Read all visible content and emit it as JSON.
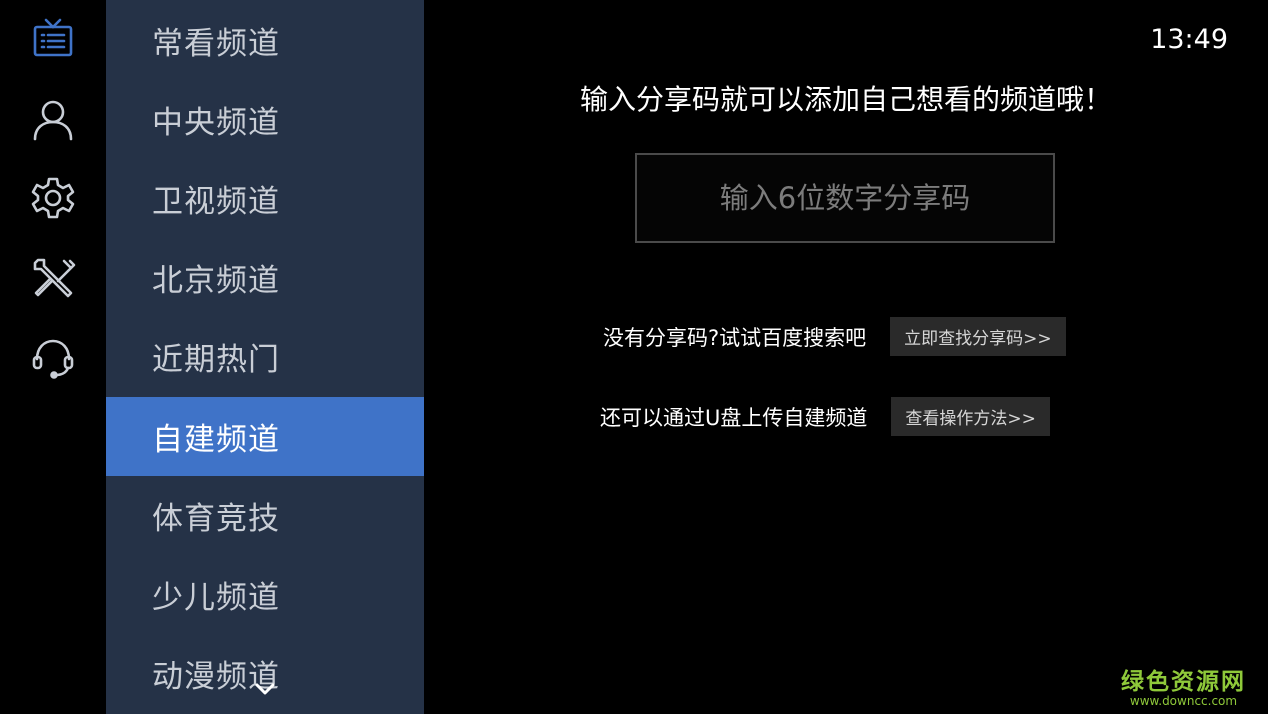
{
  "status_bar": {
    "time": "13:49"
  },
  "rail": {
    "items": [
      {
        "name": "tv-icon",
        "active": true
      },
      {
        "name": "user-icon",
        "active": false
      },
      {
        "name": "gear-icon",
        "active": false
      },
      {
        "name": "tools-icon",
        "active": false
      },
      {
        "name": "headset-icon",
        "active": false
      }
    ]
  },
  "menu": {
    "items": [
      {
        "label": "常看频道"
      },
      {
        "label": "中央频道"
      },
      {
        "label": "卫视频道"
      },
      {
        "label": "北京频道"
      },
      {
        "label": "近期热门"
      },
      {
        "label": "自建频道",
        "active": true
      },
      {
        "label": "体育竞技"
      },
      {
        "label": "少儿频道"
      },
      {
        "label": "动漫频道"
      }
    ]
  },
  "main": {
    "headline": "输入分享码就可以添加自己想看的频道哦！",
    "code_input": {
      "value": "",
      "placeholder": "输入6位数字分享码"
    },
    "search_hint": {
      "text": "没有分享码?试试百度搜索吧",
      "button": "立即查找分享码>>"
    },
    "usb_hint": {
      "text": "还可以通过U盘上传自建频道",
      "button": "查看操作方法>>"
    }
  },
  "watermark": {
    "title": "绿色资源网",
    "url": "www.downcc.com"
  },
  "colors": {
    "rail_active": "#3f73c8",
    "rail_icon": "#c9ced6",
    "menu_bg": "#253247",
    "menu_active": "#3f73c8",
    "watermark": "#8fc93a"
  }
}
